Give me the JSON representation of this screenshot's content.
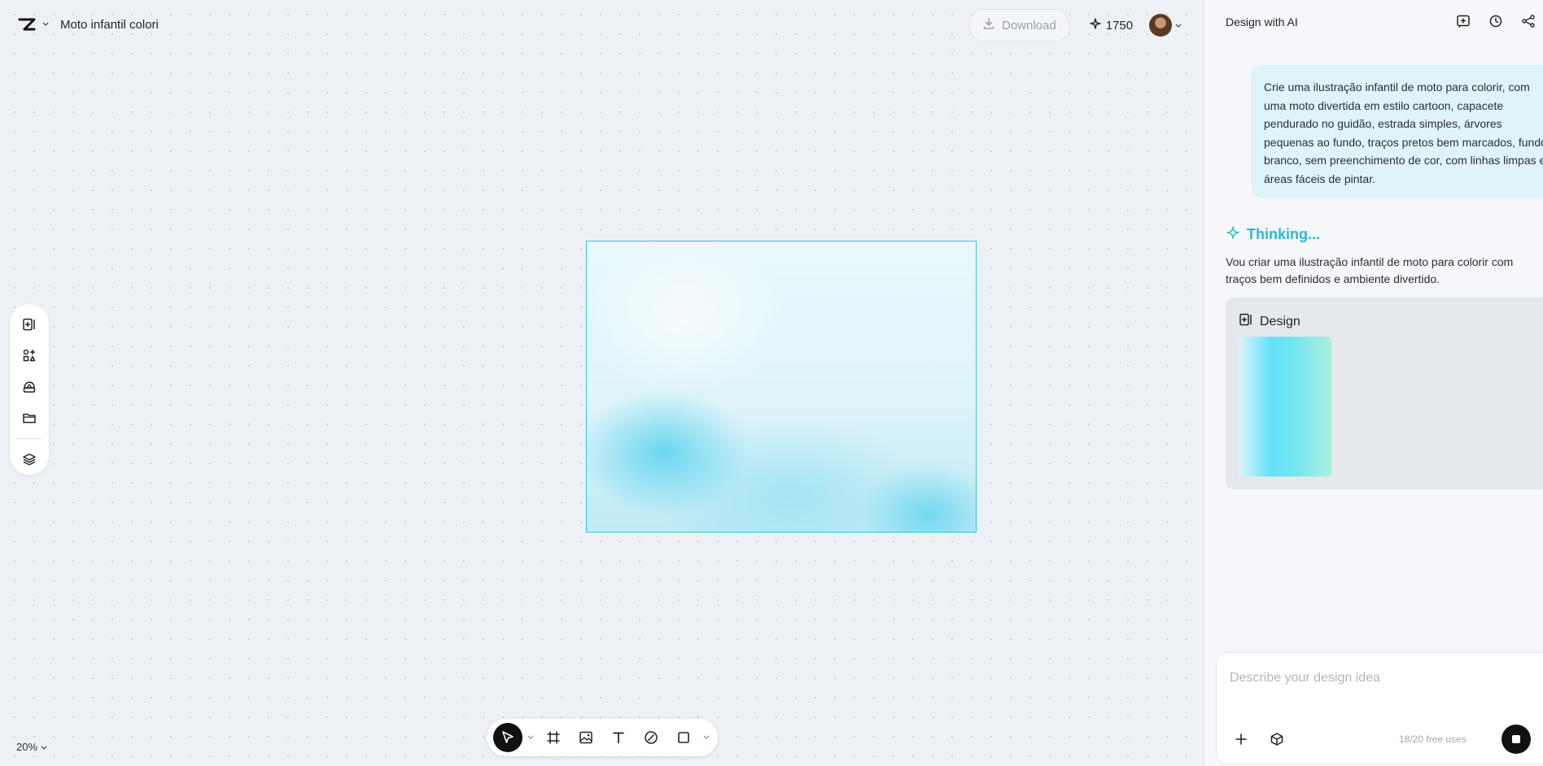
{
  "header": {
    "project_title": "Moto infantil colori",
    "download_label": "Download",
    "credits": "1750"
  },
  "canvas": {
    "zoom": "20%"
  },
  "left_rail": {
    "icons": [
      "add-page-icon",
      "elements-icon",
      "brand-kit-icon",
      "folder-icon",
      "layers-icon"
    ]
  },
  "bottom_toolbar": {
    "icons": [
      "select-pointer-icon",
      "frame-icon",
      "image-icon",
      "text-icon",
      "pen-icon",
      "shape-icon"
    ]
  },
  "panel": {
    "title": "Design with AI",
    "user_message": "Crie uma ilustração infantil de moto para colorir, com uma moto divertida em estilo cartoon, capacete pendurado no guidão, estrada simples, árvores pequenas ao fundo, traços pretos bem marcados, fundo branco, sem preenchimento de cor, com linhas limpas e áreas fáceis de pintar.",
    "thinking_label": "Thinking...",
    "assistant_reply": "Vou criar uma ilustração infantil de moto para colorir com traços bem definidos e ambiente divertido.",
    "design_card_title": "Design",
    "composer_placeholder": "Describe your design idea",
    "free_uses": "18/20 free uses"
  },
  "colors": {
    "accent": "#2bb8d4",
    "artboard_border": "#38c6e0"
  }
}
